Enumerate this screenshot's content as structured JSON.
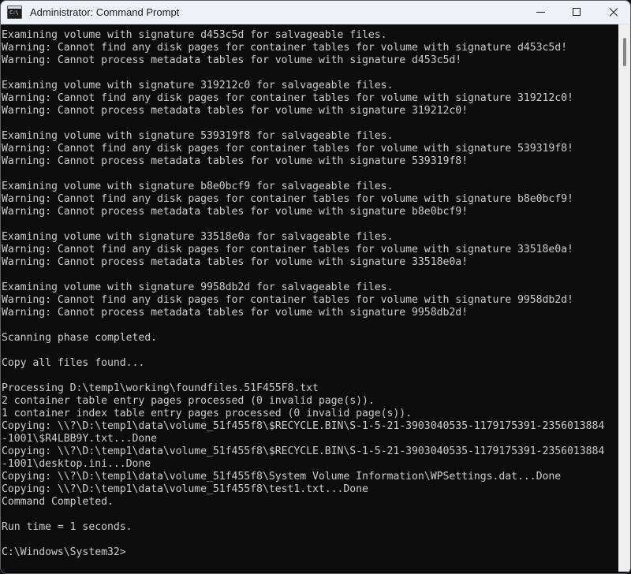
{
  "window": {
    "title": "Administrator: Command Prompt",
    "icon": "cmd-console-icon",
    "icon_prompt_text": "C:\\",
    "controls": {
      "minimize": "minimize-icon",
      "maximize": "maximize-icon",
      "close": "close-icon"
    }
  },
  "colors": {
    "titlebar_bg": "#eef2f6",
    "titlebar_text": "#1b1b1b",
    "console_bg": "#0c0c0c",
    "console_text": "#cccccc",
    "scrollbar_track": "#efefef",
    "scrollbar_thumb": "#868686",
    "window_border": "#5d6063"
  },
  "console": {
    "prompt": "C:\\Windows\\System32>",
    "lines": [
      "Examining volume with signature d453c5d for salvageable files.",
      "Warning: Cannot find any disk pages for container tables for volume with signature d453c5d!",
      "Warning: Cannot process metadata tables for volume with signature d453c5d!",
      "",
      "Examining volume with signature 319212c0 for salvageable files.",
      "Warning: Cannot find any disk pages for container tables for volume with signature 319212c0!",
      "Warning: Cannot process metadata tables for volume with signature 319212c0!",
      "",
      "Examining volume with signature 539319f8 for salvageable files.",
      "Warning: Cannot find any disk pages for container tables for volume with signature 539319f8!",
      "Warning: Cannot process metadata tables for volume with signature 539319f8!",
      "",
      "Examining volume with signature b8e0bcf9 for salvageable files.",
      "Warning: Cannot find any disk pages for container tables for volume with signature b8e0bcf9!",
      "Warning: Cannot process metadata tables for volume with signature b8e0bcf9!",
      "",
      "Examining volume with signature 33518e0a for salvageable files.",
      "Warning: Cannot find any disk pages for container tables for volume with signature 33518e0a!",
      "Warning: Cannot process metadata tables for volume with signature 33518e0a!",
      "",
      "Examining volume with signature 9958db2d for salvageable files.",
      "Warning: Cannot find any disk pages for container tables for volume with signature 9958db2d!",
      "Warning: Cannot process metadata tables for volume with signature 9958db2d!",
      "",
      "Scanning phase completed.",
      "",
      "Copy all files found...",
      "",
      "Processing D:\\temp1\\working\\foundfiles.51F455F8.txt",
      "2 container table entry pages processed (0 invalid page(s)).",
      "1 container index table entry pages processed (0 invalid page(s)).",
      "Copying: \\\\?\\D:\\temp1\\data\\volume_51f455f8\\$RECYCLE.BIN\\S-1-5-21-3903040535-1179175391-2356013884",
      "-1001\\$R4LBB9Y.txt...Done",
      "Copying: \\\\?\\D:\\temp1\\data\\volume_51f455f8\\$RECYCLE.BIN\\S-1-5-21-3903040535-1179175391-2356013884",
      "-1001\\desktop.ini...Done",
      "Copying: \\\\?\\D:\\temp1\\data\\volume_51f455f8\\System Volume Information\\WPSettings.dat...Done",
      "Copying: \\\\?\\D:\\temp1\\data\\volume_51f455f8\\test1.txt...Done",
      "Command Completed.",
      "",
      "Run time = 1 seconds.",
      "",
      "C:\\Windows\\System32>"
    ]
  }
}
